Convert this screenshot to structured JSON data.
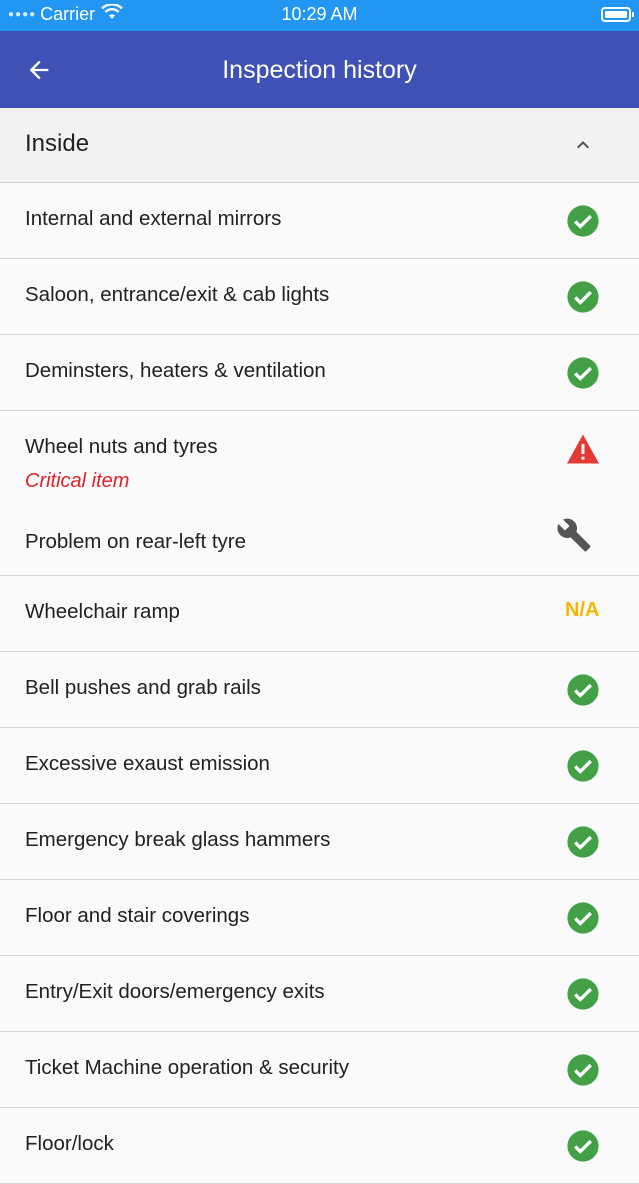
{
  "status_bar": {
    "carrier": "Carrier",
    "time": "10:29 AM"
  },
  "app_bar": {
    "title": "Inspection history"
  },
  "section": {
    "title": "Inside"
  },
  "items": [
    {
      "label": "Internal and external mirrors",
      "status": "ok"
    },
    {
      "label": "Saloon, entrance/exit & cab lights",
      "status": "ok"
    },
    {
      "label": "Deminsters, heaters & ventilation",
      "status": "ok"
    },
    {
      "label": "Wheel nuts and tyres",
      "status": "warning",
      "note": "Critical item",
      "problem": "Problem on rear-left tyre"
    },
    {
      "label": "Wheelchair ramp",
      "status": "na",
      "status_text": "N/A"
    },
    {
      "label": "Bell pushes and grab rails",
      "status": "ok"
    },
    {
      "label": "Excessive exaust emission",
      "status": "ok"
    },
    {
      "label": "Emergency break glass hammers",
      "status": "ok"
    },
    {
      "label": "Floor and stair coverings",
      "status": "ok"
    },
    {
      "label": "Entry/Exit doors/emergency exits",
      "status": "ok"
    },
    {
      "label": "Ticket Machine operation & security",
      "status": "ok"
    },
    {
      "label": "Floor/lock",
      "status": "ok"
    }
  ],
  "colors": {
    "status_bar": "#2196f3",
    "app_bar": "#3f51b5",
    "ok": "#43a047",
    "warning": "#e53935",
    "critical_text": "#e0202a",
    "na": "#f5b800"
  }
}
